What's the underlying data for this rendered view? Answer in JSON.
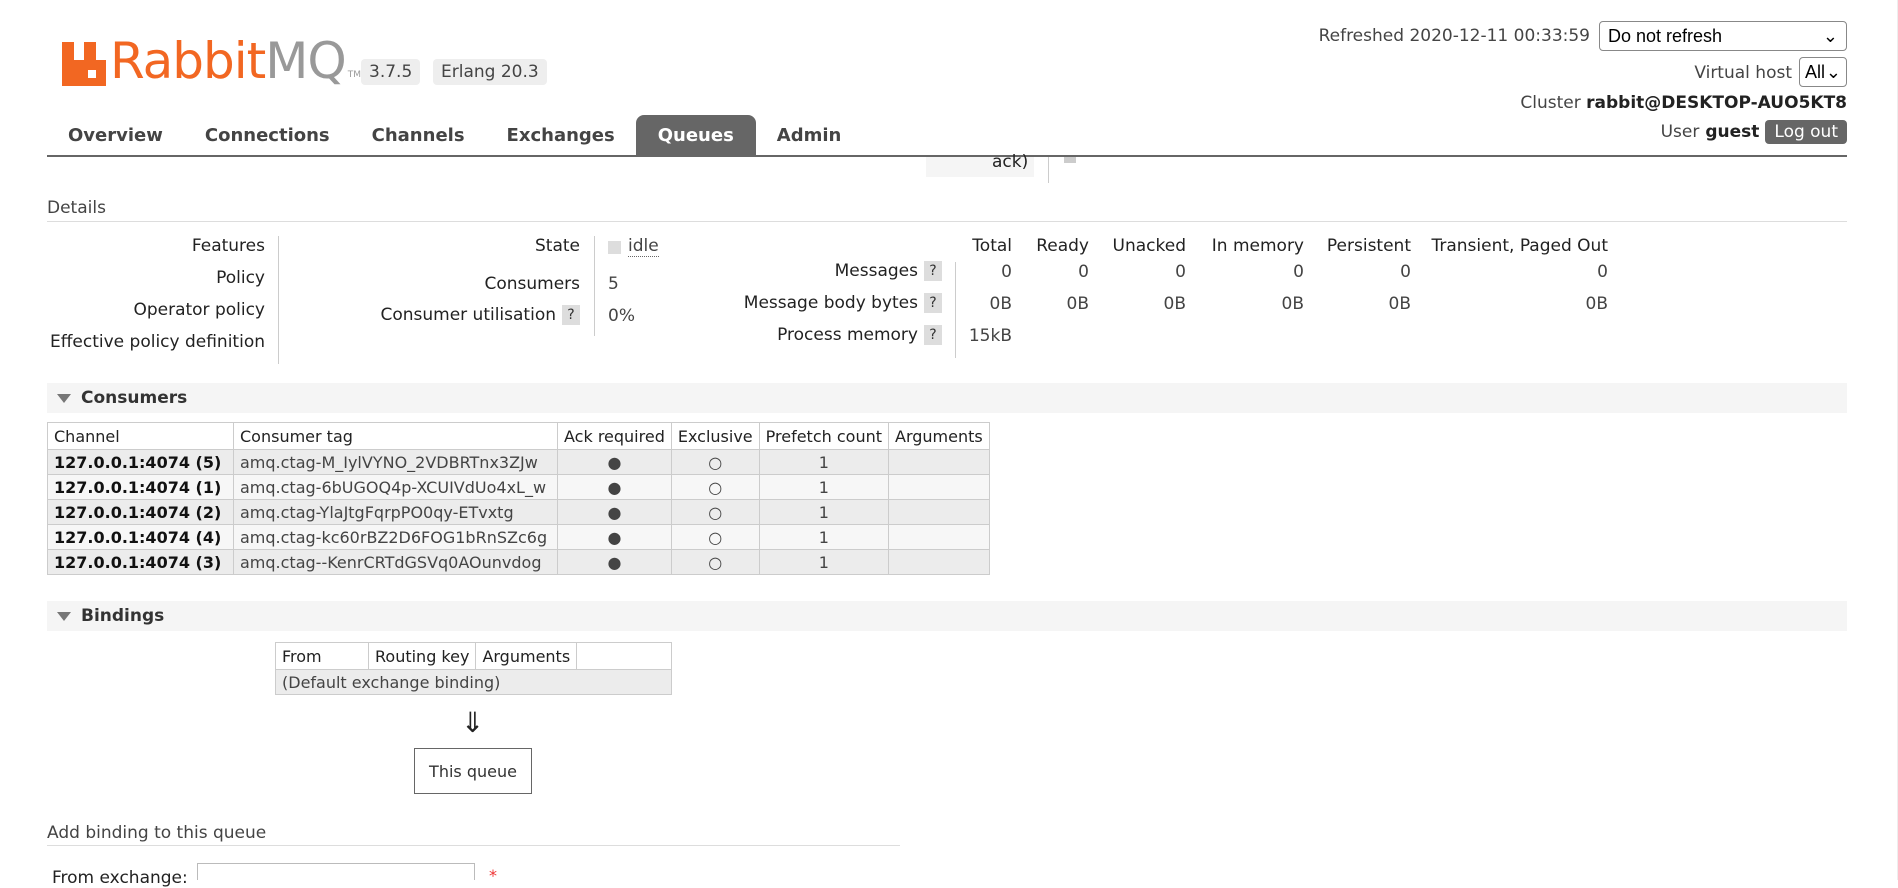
{
  "header": {
    "logo": {
      "brand_a": "Rabbit",
      "brand_b": "MQ",
      "tm": "TM"
    },
    "version": "3.7.5",
    "erlang": "Erlang 20.3",
    "refreshed_label": "Refreshed",
    "refreshed_time": "2020-12-11 00:33:59",
    "refresh_select": "Do not refresh",
    "vhost_label": "Virtual host",
    "vhost_select": "All",
    "cluster_label": "Cluster",
    "cluster_name": "rabbit@DESKTOP-AUO5KT8",
    "user_label": "User",
    "user_name": "guest",
    "logout": "Log out"
  },
  "nav": {
    "tabs": [
      "Overview",
      "Connections",
      "Channels",
      "Exchanges",
      "Queues",
      "Admin"
    ],
    "active": "Queues"
  },
  "clipped_text": "ack)",
  "details": {
    "title": "Details",
    "left_labels": [
      "Features",
      "Policy",
      "Operator policy",
      "Effective policy definition"
    ],
    "state_label": "State",
    "state_value": "idle",
    "consumers_label": "Consumers",
    "consumers_value": "5",
    "utilisation_label": "Consumer utilisation",
    "utilisation_value": "0%",
    "qmark": "?",
    "stats": {
      "headers": [
        "Total",
        "Ready",
        "Unacked",
        "In memory",
        "Persistent",
        "Transient, Paged Out"
      ],
      "messages_label": "Messages",
      "messages": [
        "0",
        "0",
        "0",
        "0",
        "0",
        "0"
      ],
      "bytes_label": "Message body bytes",
      "bytes": [
        "0B",
        "0B",
        "0B",
        "0B",
        "0B",
        "0B"
      ],
      "process_label": "Process memory",
      "process_value": "15kB"
    }
  },
  "consumers": {
    "title": "Consumers",
    "columns": [
      "Channel",
      "Consumer tag",
      "Ack required",
      "Exclusive",
      "Prefetch count",
      "Arguments"
    ],
    "rows": [
      {
        "channel": "127.0.0.1:4074 (5)",
        "tag": "amq.ctag-M_IylVYNO_2VDBRTnx3ZJw",
        "ack": "●",
        "exclusive": "○",
        "prefetch": "1",
        "args": ""
      },
      {
        "channel": "127.0.0.1:4074 (1)",
        "tag": "amq.ctag-6bUGOQ4p-XCUIVdUo4xL_w",
        "ack": "●",
        "exclusive": "○",
        "prefetch": "1",
        "args": ""
      },
      {
        "channel": "127.0.0.1:4074 (2)",
        "tag": "amq.ctag-YlaJtgFqrpPO0qy-ETvxtg",
        "ack": "●",
        "exclusive": "○",
        "prefetch": "1",
        "args": ""
      },
      {
        "channel": "127.0.0.1:4074 (4)",
        "tag": "amq.ctag-kc60rBZ2D6FOG1bRnSZc6g",
        "ack": "●",
        "exclusive": "○",
        "prefetch": "1",
        "args": ""
      },
      {
        "channel": "127.0.0.1:4074 (3)",
        "tag": "amq.ctag--KenrCRTdGSVq0AOunvdog",
        "ack": "●",
        "exclusive": "○",
        "prefetch": "1",
        "args": ""
      }
    ]
  },
  "bindings": {
    "title": "Bindings",
    "columns": [
      "From",
      "Routing key",
      "Arguments",
      ""
    ],
    "default_row": "(Default exchange binding)",
    "arrow": "⇓",
    "this_queue": "This queue"
  },
  "add_binding": {
    "title": "Add binding to this queue",
    "from_label": "From exchange:",
    "required": "*"
  }
}
